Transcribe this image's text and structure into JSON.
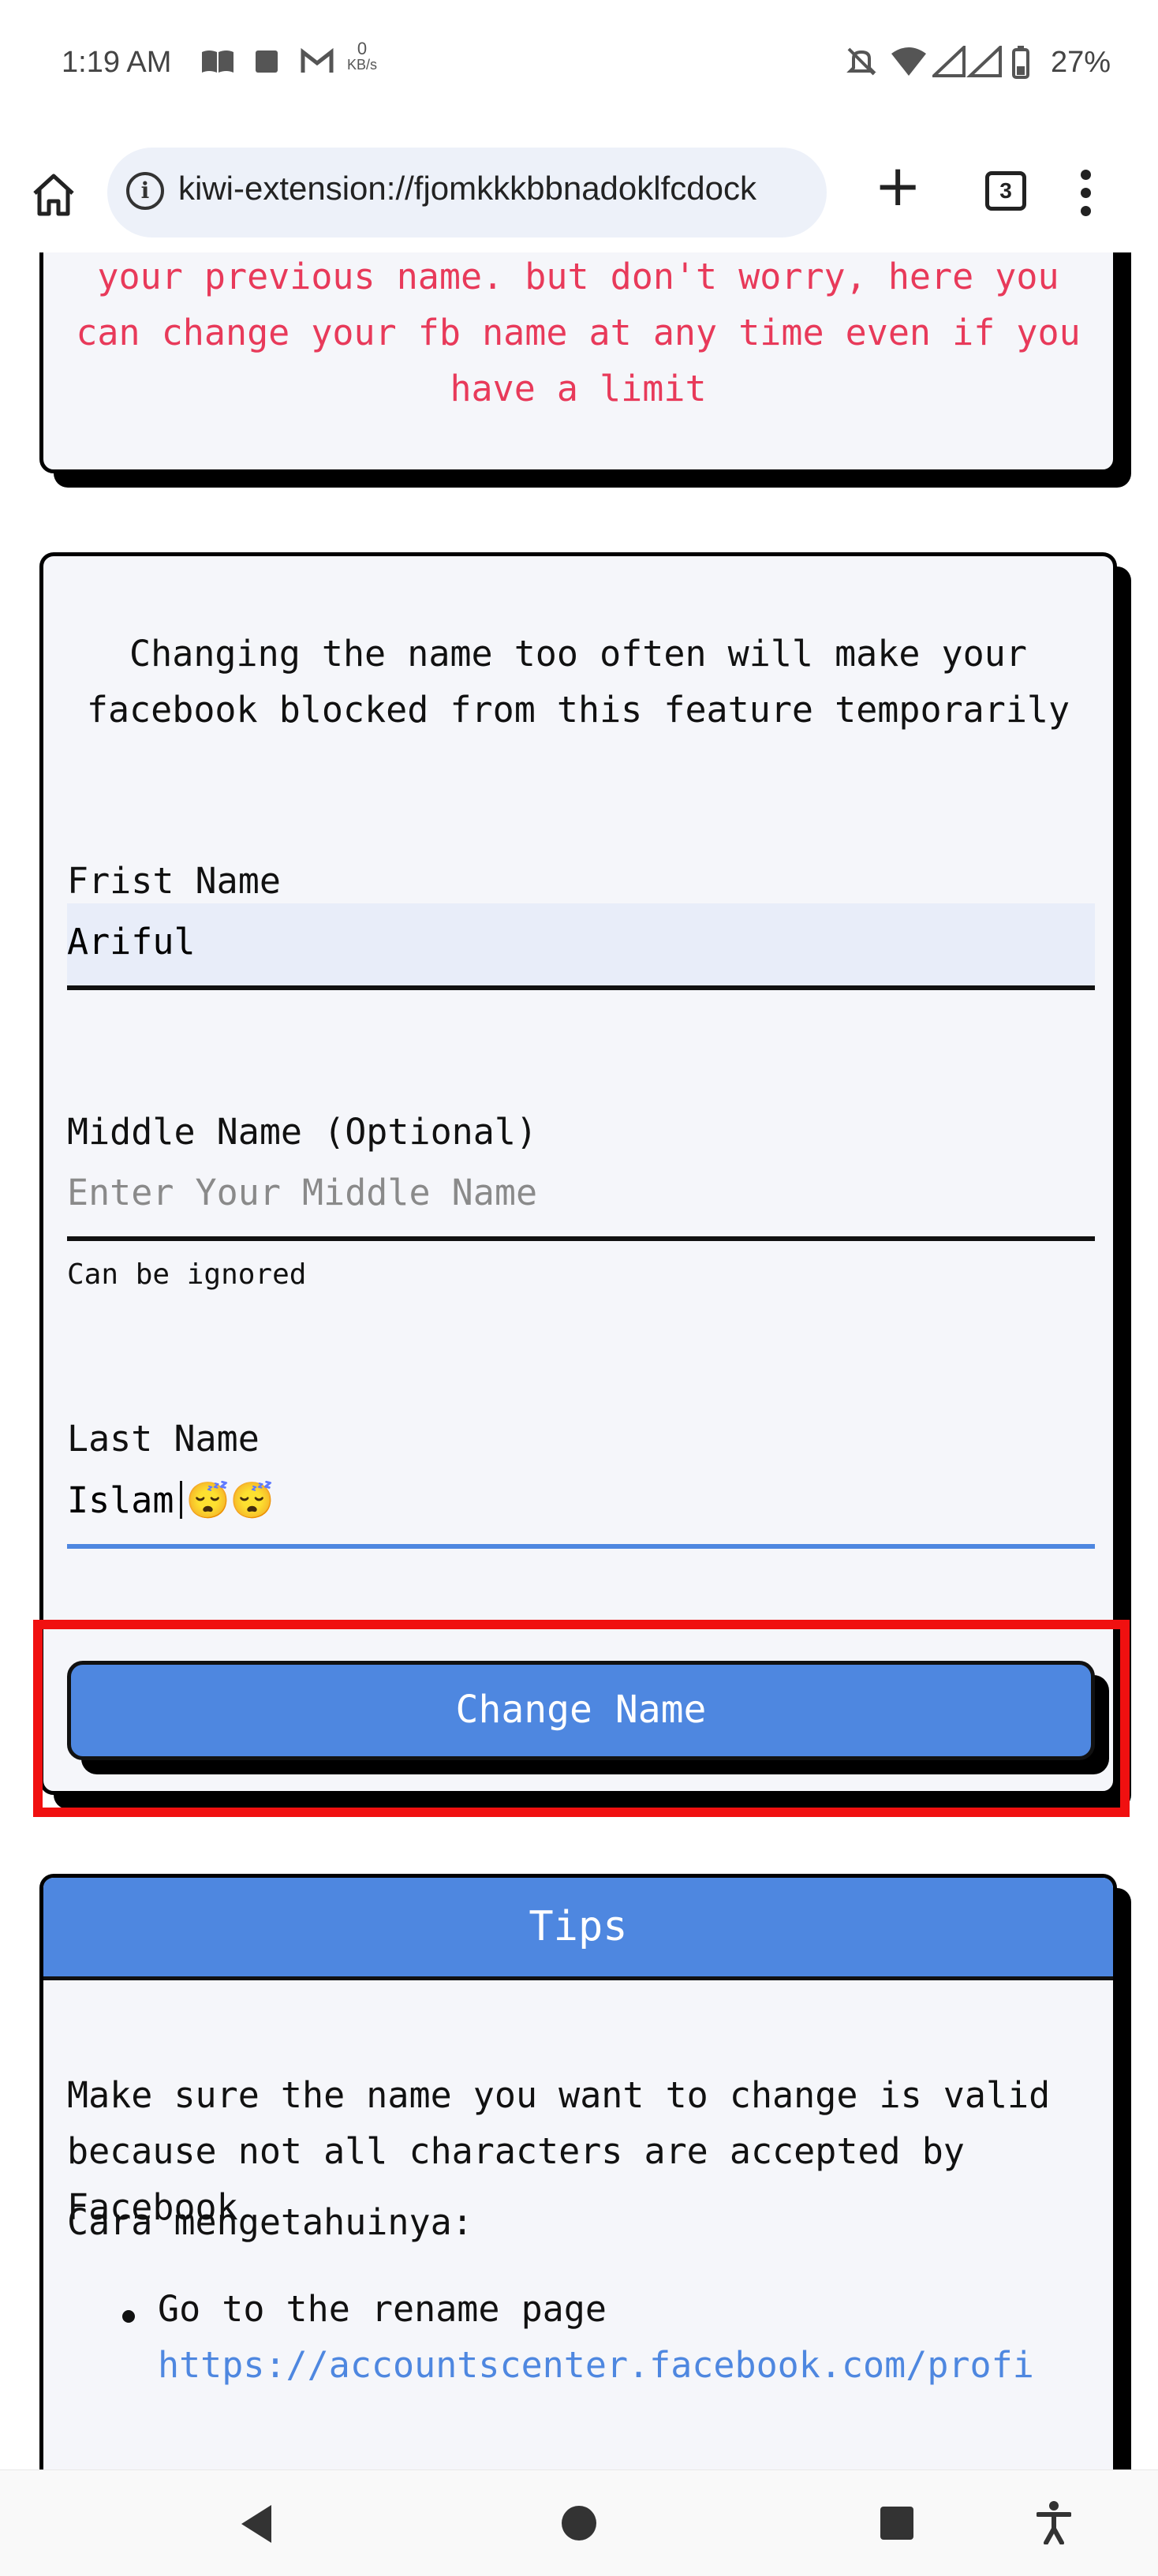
{
  "status_bar": {
    "time": "1:19 AM",
    "net_speed_value": "0",
    "net_speed_unit": "KB/s",
    "battery": "27%"
  },
  "browser": {
    "url": "kiwi-extension://fjomkkkbbnadoklfcdock",
    "tab_count": "3"
  },
  "warning_card": {
    "text": "your previous name. but don't worry, here you can change your fb name at any time even if you have a limit"
  },
  "form": {
    "intro": "Changing the name too often will make your facebook blocked from this feature temporarily",
    "first_name_label": "Frist Name",
    "first_name_value": "Ariful",
    "middle_name_label": "Middle Name (Optional)",
    "middle_name_placeholder": "Enter Your Middle Name",
    "middle_name_hint": "Can be ignored",
    "last_name_label": "Last Name",
    "last_name_value": "Islam",
    "last_name_emoji": "😴😴",
    "submit_label": "Change Name"
  },
  "tips": {
    "title": "Tips",
    "text": "Make sure the name you want to change is valid because not all characters are accepted by Facebook",
    "cara": "Cara mengetahuinya:",
    "step1": "Go to the rename page",
    "step1_link": "https://accountscenter.facebook.com/profi"
  },
  "icons": {
    "status": [
      "book-icon",
      "stop-icon",
      "gmail-icon",
      "mute-icon",
      "wifi-icon",
      "signal-icon",
      "battery-icon"
    ],
    "toolbar": [
      "home-icon",
      "info-icon",
      "plus-icon",
      "tabs-icon",
      "more-icon"
    ],
    "nav": [
      "back-icon",
      "home-circle-icon",
      "recents-icon",
      "accessibility-icon"
    ]
  },
  "colors": {
    "accent": "#4e87e0",
    "warning_text": "#e83a5a",
    "highlight": "#f01010"
  }
}
